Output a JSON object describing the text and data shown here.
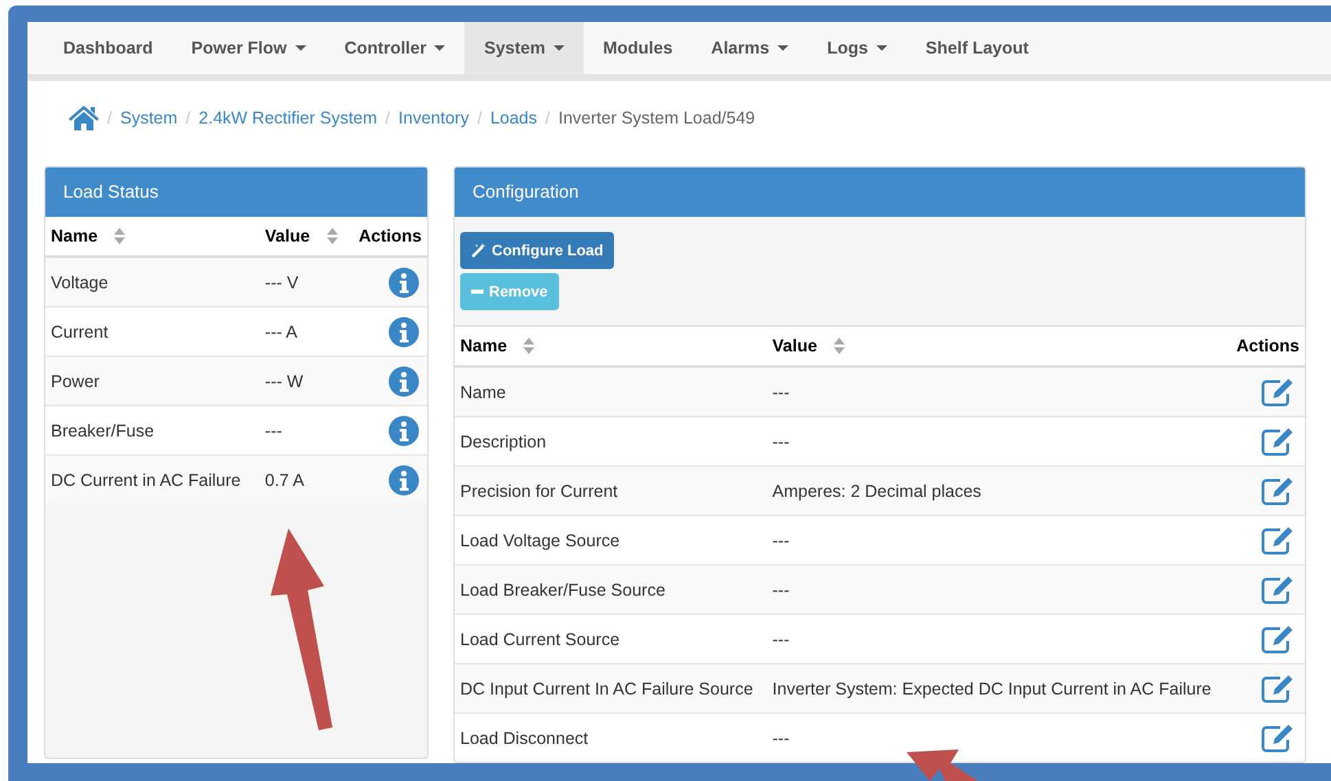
{
  "nav": [
    {
      "label": "Dashboard",
      "dropdown": false,
      "selected": false
    },
    {
      "label": "Power Flow",
      "dropdown": true,
      "selected": false
    },
    {
      "label": "Controller",
      "dropdown": true,
      "selected": false
    },
    {
      "label": "System",
      "dropdown": true,
      "selected": true
    },
    {
      "label": "Modules",
      "dropdown": false,
      "selected": false
    },
    {
      "label": "Alarms",
      "dropdown": true,
      "selected": false
    },
    {
      "label": "Logs",
      "dropdown": true,
      "selected": false
    },
    {
      "label": "Shelf Layout",
      "dropdown": false,
      "selected": false
    }
  ],
  "breadcrumb": {
    "links": [
      {
        "separator": "/",
        "label": "System"
      },
      {
        "separator": "/",
        "label": "2.4kW Rectifier System"
      },
      {
        "separator": "/",
        "label": "Inventory"
      },
      {
        "separator": "/",
        "label": "Loads"
      }
    ],
    "current": {
      "separator": "/",
      "label": "Inverter System Load/549"
    }
  },
  "load_status": {
    "title": "Load Status",
    "columns": [
      {
        "label": "Name",
        "sortable": true
      },
      {
        "label": "Value",
        "sortable": true
      },
      {
        "label": "Actions",
        "sortable": false
      }
    ],
    "rows": [
      {
        "name": "Voltage",
        "value": "--- V"
      },
      {
        "name": "Current",
        "value": "--- A"
      },
      {
        "name": "Power",
        "value": "--- W"
      },
      {
        "name": "Breaker/Fuse",
        "value": "---"
      },
      {
        "name": "DC Current in AC Failure",
        "value": "0.7 A"
      }
    ]
  },
  "configuration": {
    "title": "Configuration",
    "buttons": [
      {
        "label": "Configure Load",
        "kind": "primary"
      },
      {
        "label": "Remove",
        "kind": "info"
      }
    ],
    "columns": [
      {
        "label": "Name",
        "sortable": true
      },
      {
        "label": "Value",
        "sortable": true
      },
      {
        "label": "Actions",
        "sortable": false
      }
    ],
    "rows": [
      {
        "name": "Name",
        "value": "---"
      },
      {
        "name": "Description",
        "value": "---"
      },
      {
        "name": "Precision for Current",
        "value": "Amperes: 2 Decimal places"
      },
      {
        "name": "Load Voltage Source",
        "value": "---"
      },
      {
        "name": "Load Breaker/Fuse Source",
        "value": "---"
      },
      {
        "name": "Load Current Source",
        "value": "---"
      },
      {
        "name": "DC Input Current In AC Failure Source",
        "value": "Inverter System: Expected DC Input Current in AC Failure"
      },
      {
        "name": "Load Disconnect",
        "value": "---"
      }
    ]
  }
}
